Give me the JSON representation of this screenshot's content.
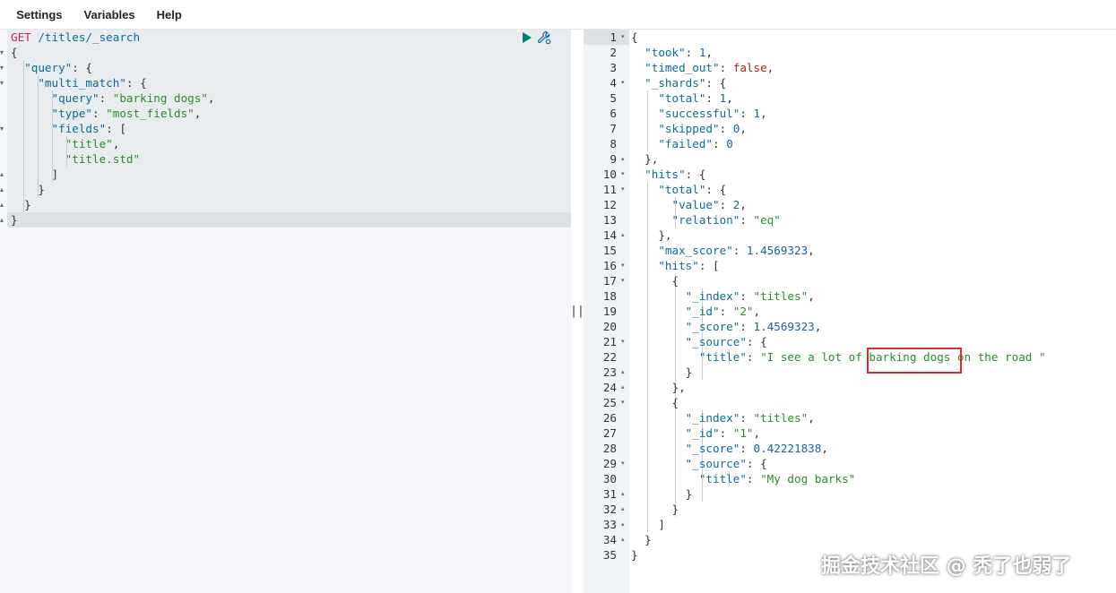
{
  "menu": [
    "y",
    "Settings",
    "Variables",
    "Help"
  ],
  "request": {
    "lines": [
      [
        [
          "m",
          "GET"
        ],
        [
          "p",
          " "
        ],
        [
          "u",
          "/titles/_search"
        ]
      ],
      [
        [
          "p",
          "{"
        ]
      ],
      [
        [
          "p",
          "  "
        ],
        [
          "k",
          "\"query\""
        ],
        [
          "p",
          ": {"
        ]
      ],
      [
        [
          "p",
          "    "
        ],
        [
          "k",
          "\"multi_match\""
        ],
        [
          "p",
          ": {"
        ]
      ],
      [
        [
          "p",
          "      "
        ],
        [
          "k",
          "\"query\""
        ],
        [
          "p",
          ": "
        ],
        [
          "s",
          "\"barking dogs\""
        ],
        [
          "p",
          ","
        ]
      ],
      [
        [
          "p",
          "      "
        ],
        [
          "k",
          "\"type\""
        ],
        [
          "p",
          ": "
        ],
        [
          "s",
          "\"most_fields\""
        ],
        [
          "p",
          ","
        ]
      ],
      [
        [
          "p",
          "      "
        ],
        [
          "k",
          "\"fields\""
        ],
        [
          "p",
          ": ["
        ]
      ],
      [
        [
          "p",
          "        "
        ],
        [
          "s",
          "\"title\""
        ],
        [
          "p",
          ","
        ]
      ],
      [
        [
          "p",
          "        "
        ],
        [
          "s",
          "\"title.std\""
        ]
      ],
      [
        [
          "p",
          "      ]"
        ]
      ],
      [
        [
          "p",
          "    }"
        ]
      ],
      [
        [
          "p",
          "  }"
        ]
      ],
      [
        [
          "p",
          "}"
        ]
      ]
    ],
    "gutter_marks": [
      "",
      "▾",
      "▾",
      "▾",
      "",
      "",
      "▾",
      "",
      "",
      "▴",
      "▴",
      "▴",
      "▴"
    ]
  },
  "divider_handle": "||",
  "response": {
    "line_numbers": [
      "1",
      "2",
      "3",
      "4",
      "5",
      "6",
      "7",
      "8",
      "9",
      "10",
      "11",
      "12",
      "13",
      "14",
      "15",
      "16",
      "17",
      "18",
      "19",
      "20",
      "21",
      "22",
      "23",
      "24",
      "25",
      "26",
      "27",
      "28",
      "29",
      "30",
      "31",
      "32",
      "33",
      "34",
      "35"
    ],
    "fold_marks": [
      "▾",
      "",
      "",
      "▾",
      "",
      "",
      "",
      "",
      "▴",
      "▾",
      "▾",
      "",
      "",
      "▴",
      "",
      "▾",
      "▾",
      "",
      "",
      "",
      "▾",
      "",
      "▴",
      "▴",
      "▾",
      "",
      "",
      "",
      "▾",
      "",
      "▴",
      "▴",
      "▴",
      "▴",
      ""
    ],
    "lines": [
      [
        [
          "p",
          "{"
        ]
      ],
      [
        [
          "p",
          "  "
        ],
        [
          "k",
          "\"took\""
        ],
        [
          "p",
          ": "
        ],
        [
          "n",
          "1"
        ],
        [
          "p",
          ","
        ]
      ],
      [
        [
          "p",
          "  "
        ],
        [
          "k",
          "\"timed_out\""
        ],
        [
          "p",
          ": "
        ],
        [
          "b",
          "false"
        ],
        [
          "p",
          ","
        ]
      ],
      [
        [
          "p",
          "  "
        ],
        [
          "k",
          "\"_shards\""
        ],
        [
          "p",
          ": {"
        ]
      ],
      [
        [
          "p",
          "    "
        ],
        [
          "k",
          "\"total\""
        ],
        [
          "p",
          ": "
        ],
        [
          "n",
          "1"
        ],
        [
          "p",
          ","
        ]
      ],
      [
        [
          "p",
          "    "
        ],
        [
          "k",
          "\"successful\""
        ],
        [
          "p",
          ": "
        ],
        [
          "n",
          "1"
        ],
        [
          "p",
          ","
        ]
      ],
      [
        [
          "p",
          "    "
        ],
        [
          "k",
          "\"skipped\""
        ],
        [
          "p",
          ": "
        ],
        [
          "n",
          "0"
        ],
        [
          "p",
          ","
        ]
      ],
      [
        [
          "p",
          "    "
        ],
        [
          "k",
          "\"failed\""
        ],
        [
          "p",
          ": "
        ],
        [
          "n",
          "0"
        ]
      ],
      [
        [
          "p",
          "  },"
        ]
      ],
      [
        [
          "p",
          "  "
        ],
        [
          "k",
          "\"hits\""
        ],
        [
          "p",
          ": {"
        ]
      ],
      [
        [
          "p",
          "    "
        ],
        [
          "k",
          "\"total\""
        ],
        [
          "p",
          ": {"
        ]
      ],
      [
        [
          "p",
          "      "
        ],
        [
          "k",
          "\"value\""
        ],
        [
          "p",
          ": "
        ],
        [
          "n",
          "2"
        ],
        [
          "p",
          ","
        ]
      ],
      [
        [
          "p",
          "      "
        ],
        [
          "k",
          "\"relation\""
        ],
        [
          "p",
          ": "
        ],
        [
          "s",
          "\"eq\""
        ]
      ],
      [
        [
          "p",
          "    },"
        ]
      ],
      [
        [
          "p",
          "    "
        ],
        [
          "k",
          "\"max_score\""
        ],
        [
          "p",
          ": "
        ],
        [
          "n",
          "1.4569323"
        ],
        [
          "p",
          ","
        ]
      ],
      [
        [
          "p",
          "    "
        ],
        [
          "k",
          "\"hits\""
        ],
        [
          "p",
          ": ["
        ]
      ],
      [
        [
          "p",
          "      {"
        ]
      ],
      [
        [
          "p",
          "        "
        ],
        [
          "k",
          "\"_index\""
        ],
        [
          "p",
          ": "
        ],
        [
          "s",
          "\"titles\""
        ],
        [
          "p",
          ","
        ]
      ],
      [
        [
          "p",
          "        "
        ],
        [
          "k",
          "\"_id\""
        ],
        [
          "p",
          ": "
        ],
        [
          "s",
          "\"2\""
        ],
        [
          "p",
          ","
        ]
      ],
      [
        [
          "p",
          "        "
        ],
        [
          "k",
          "\"_score\""
        ],
        [
          "p",
          ": "
        ],
        [
          "n",
          "1.4569323"
        ],
        [
          "p",
          ","
        ]
      ],
      [
        [
          "p",
          "        "
        ],
        [
          "k",
          "\"_source\""
        ],
        [
          "p",
          ": {"
        ]
      ],
      [
        [
          "p",
          "          "
        ],
        [
          "k",
          "\"title\""
        ],
        [
          "p",
          ": "
        ],
        [
          "s",
          "\"I see a lot of barking dogs on the road \""
        ]
      ],
      [
        [
          "p",
          "        }"
        ]
      ],
      [
        [
          "p",
          "      },"
        ]
      ],
      [
        [
          "p",
          "      {"
        ]
      ],
      [
        [
          "p",
          "        "
        ],
        [
          "k",
          "\"_index\""
        ],
        [
          "p",
          ": "
        ],
        [
          "s",
          "\"titles\""
        ],
        [
          "p",
          ","
        ]
      ],
      [
        [
          "p",
          "        "
        ],
        [
          "k",
          "\"_id\""
        ],
        [
          "p",
          ": "
        ],
        [
          "s",
          "\"1\""
        ],
        [
          "p",
          ","
        ]
      ],
      [
        [
          "p",
          "        "
        ],
        [
          "k",
          "\"_score\""
        ],
        [
          "p",
          ": "
        ],
        [
          "n",
          "0.42221838"
        ],
        [
          "p",
          ","
        ]
      ],
      [
        [
          "p",
          "        "
        ],
        [
          "k",
          "\"_source\""
        ],
        [
          "p",
          ": {"
        ]
      ],
      [
        [
          "p",
          "          "
        ],
        [
          "k",
          "\"title\""
        ],
        [
          "p",
          ": "
        ],
        [
          "s",
          "\"My dog barks\""
        ]
      ],
      [
        [
          "p",
          "        }"
        ]
      ],
      [
        [
          "p",
          "      }"
        ]
      ],
      [
        [
          "p",
          "    ]"
        ]
      ],
      [
        [
          "p",
          "  }"
        ]
      ],
      [
        [
          "p",
          "}"
        ]
      ]
    ]
  },
  "watermark": "掘金技术社区 @ 秃了也弱了",
  "colors": {
    "key": "#0a6a9e",
    "string": "#2b8a2b",
    "number": "#1a5fa3",
    "boolean": "#b81c1c",
    "method": "#c2246b",
    "highlight_border": "#d62d2d",
    "run": "#017d73"
  }
}
